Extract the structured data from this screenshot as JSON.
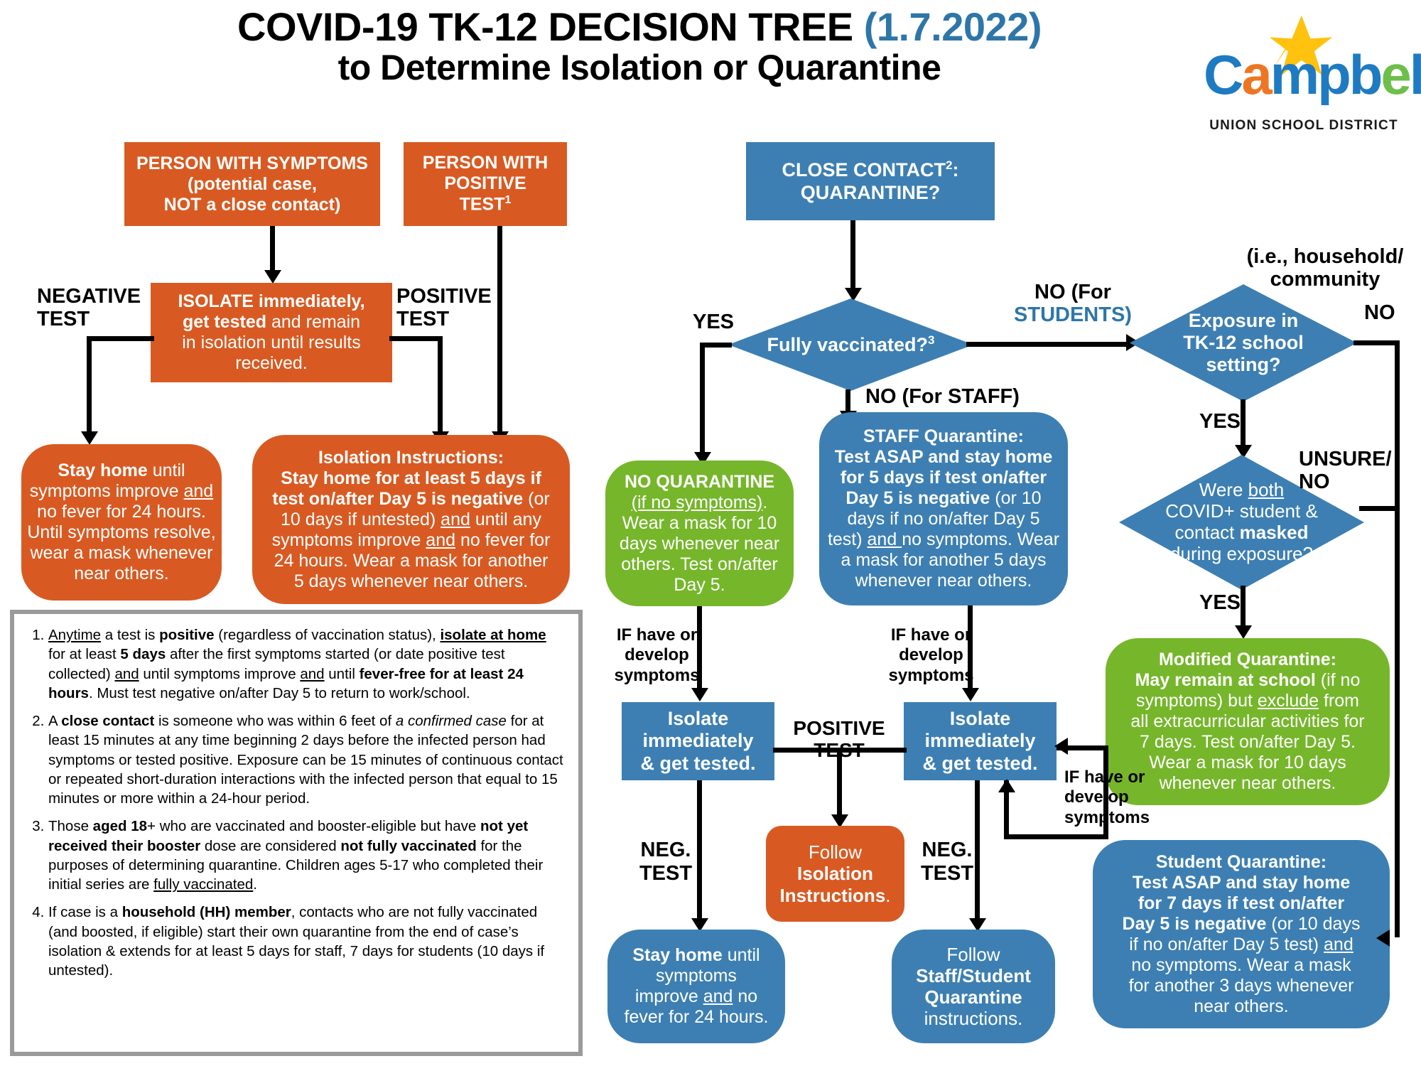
{
  "header": {
    "title_line1_main": "COVID-19 TK-12 DECISION TREE ",
    "title_line1_date": "(1.7.2022)",
    "title_line2": "to Determine Isolation or Quarantine"
  },
  "logo": {
    "star_icon": "star-icon",
    "word_c": "C",
    "word_a": "a",
    "word_mpb": "mpb",
    "word_e": "e",
    "word_ll": "ll",
    "subtitle": "UNION SCHOOL DISTRICT"
  },
  "nodes": {
    "person_symptoms": "PERSON WITH SYMPTOMS (potential case, NOT a close contact)",
    "person_positive": "PERSON WITH POSITIVE TEST¹",
    "isolate_immediately": "ISOLATE immediately, get tested and remain in isolation until results received.",
    "stay_home_left": "Stay home until symptoms improve and no fever for 24 hours. Until symptoms resolve, wear a mask whenever near others.",
    "isolation_instructions": "Isolation Instructions: Stay home for at least 5 days if test on/after Day 5 is negative (or 10 days if untested) and until any symptoms improve and no fever for 24 hours. Wear a mask for another 5 days whenever near others.",
    "close_contact": "CLOSE CONTACT²: QUARANTINE?",
    "fully_vaccinated": "Fully vaccinated?³",
    "exposure_tk12": "Exposure in TK-12 school setting?",
    "both_masked": "Were both COVID+ student & contact masked during exposure?",
    "no_quarantine": "NO QUARANTINE (if no symptoms). Wear a mask for 10 days whenever near others. Test on/after Day 5.",
    "staff_quarantine": "STAFF Quarantine: Test ASAP and stay home for 5 days if test on/after Day 5 is negative (or 10 days if no on/after Day 5 test) and no symptoms. Wear a mask for another 5 days whenever near others.",
    "modified_quarantine": "Modified Quarantine: May remain at school (if no symptoms) but exclude from all extracurricular activities for 7 days. Test on/after Day 5. Wear a mask for 10 days whenever near others.",
    "student_quarantine": "Student Quarantine: Test ASAP and stay home for 7 days if test on/after Day 5 is negative (or 10 days if no on/after Day 5 test) and no symptoms. Wear a mask for another 3 days whenever near others.",
    "isolate_left": "Isolate immediately & get tested.",
    "isolate_right": "Isolate immediately & get tested.",
    "follow_isolation": "Follow Isolation Instructions.",
    "stay_home_bottom": "Stay home until symptoms improve and no fever for 24 hours.",
    "follow_staff_student": "Follow Staff/Student Quarantine instructions."
  },
  "edge_labels": {
    "negative_test": "NEGATIVE TEST",
    "positive_test": "POSITIVE TEST",
    "yes_vax": "YES",
    "no_students_l1": "NO (For",
    "no_students_l2": "STUDENTS)",
    "no_staff": "NO (For STAFF)",
    "ie_household_l1": "(i.e., household/",
    "ie_household_l2": "community",
    "no_right": "NO",
    "yes_exposure": "YES",
    "unsure_no_l1": "UNSURE/",
    "unsure_no_l2": "NO",
    "yes_masked": "YES",
    "if_symptoms_left": "IF have or develop symptoms",
    "if_symptoms_mid": "IF have or develop symptoms",
    "if_symptoms_right": "IF have or develop symptoms",
    "positive_test_mid": "POSITIVE TEST",
    "neg_test_left_l1": "NEG.",
    "neg_test_left_l2": "TEST",
    "neg_test_right_l1": "NEG.",
    "neg_test_right_l2": "TEST"
  },
  "footnotes": {
    "n1": "Anytime a test is positive (regardless of vaccination status), isolate at home for at least 5 days after the first symptoms started (or date positive test collected) and until symptoms improve and until fever-free for at least 24 hours. Must test negative on/after Day 5 to return to work/school.",
    "n2": "A close contact is someone who was within 6 feet of a confirmed case for at least 15 minutes at any time beginning 2 days before the infected person had symptoms or tested positive. Exposure can be 15 minutes of continuous contact or repeated short-duration interactions with the infected person that equal to 15 minutes or more within a 24-hour period.",
    "n3": "Those aged 18+ who are vaccinated and booster-eligible but have not yet received their booster dose are considered not fully vaccinated for the purposes of determining quarantine. Children ages 5-17 who completed their initial series are fully vaccinated.",
    "n4": "If case is a household (HH) member, contacts who are not fully vaccinated (and boosted, if eligible) start their own quarantine from the end of case's isolation & extends for at least 5 days for staff, 7 days for students (10 days if untested)."
  },
  "colors": {
    "orange": "#D85A22",
    "blue": "#3D7FB2",
    "green": "#76B62B",
    "title_blue": "#2E76A8",
    "note_border": "#9a9a9a"
  }
}
